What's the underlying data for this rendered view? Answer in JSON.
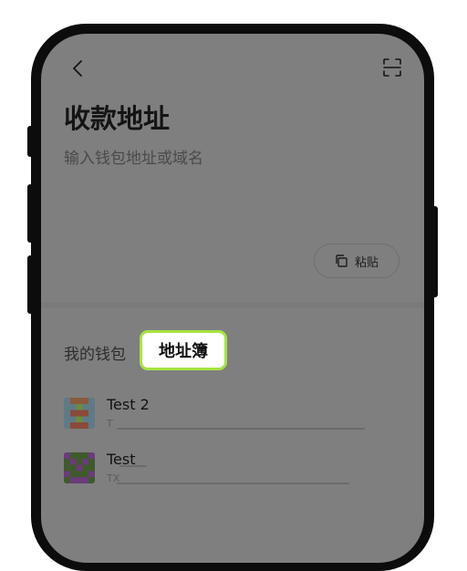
{
  "header": {
    "back_icon": "chevron-left-icon",
    "scan_icon": "scan-icon"
  },
  "page": {
    "title": "收款地址",
    "input_placeholder": "输入钱包地址或域名",
    "paste_label": "粘贴",
    "paste_icon": "copy-icon"
  },
  "tabs": {
    "my_wallet": "我的钱包",
    "address_book": "地址簿",
    "active": "address_book"
  },
  "contacts": [
    {
      "name": "Test 2",
      "address": "T",
      "avatar_icon": "identicon-avatar"
    },
    {
      "name": "Test",
      "address": "TX",
      "avatar_icon": "identicon-avatar"
    }
  ],
  "colors": {
    "overlay": "#7f7f7f",
    "highlight_border": "#a6e33f",
    "frame": "#0c0c0c"
  }
}
